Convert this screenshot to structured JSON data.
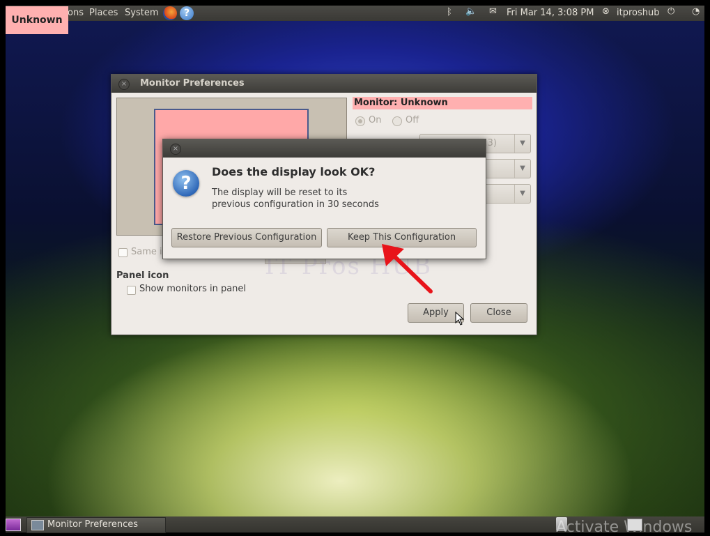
{
  "overlay_tag": "Unknown",
  "top_panel": {
    "menus": [
      "ons",
      "Places",
      "System"
    ],
    "clock": "Fri Mar 14,  3:08 PM",
    "user": "itproshub",
    "icons": [
      "firefox-icon",
      "help-icon",
      "bluetooth-icon",
      "volume-icon",
      "mail-icon",
      "user-icon",
      "power-icon",
      "network-icon"
    ]
  },
  "window": {
    "title": "Monitor Preferences",
    "monitor_label": "Monitor: Unknown",
    "on_label": "On",
    "off_label": "Off",
    "combo_value": "(4:3)",
    "same_image_label": "Same i",
    "panel_icon_title": "Panel icon",
    "show_monitors_label": "Show monitors in panel",
    "apply_label": "Apply",
    "close_label": "Close",
    "watermark": "IT Pros HUB"
  },
  "dialog": {
    "title": "Does the display look OK?",
    "message_line1": "The display will be reset to its",
    "message_line2": "previous configuration in 30 seconds",
    "restore_label": "Restore Previous Configuration",
    "keep_label": "Keep This Configuration"
  },
  "bottom_panel": {
    "task_label": "Monitor Preferences",
    "activate_text": "Activate Windows"
  },
  "colors": {
    "highlight": "#ffb0b0",
    "panel": "#3c3b37",
    "arrow": "#e8141a"
  }
}
